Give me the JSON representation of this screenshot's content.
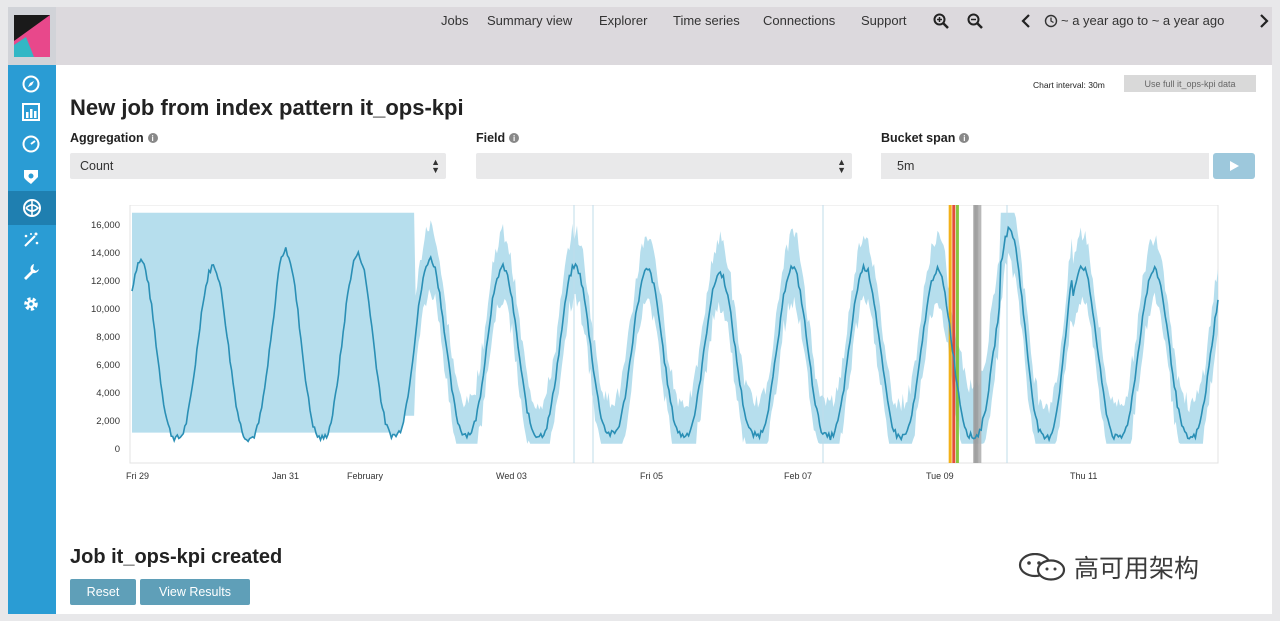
{
  "nav": {
    "items": [
      "Jobs",
      "Summary view",
      "Explorer",
      "Time series",
      "Connections",
      "Support"
    ],
    "time_range": "~ a year ago to ~ a year ago",
    "icons": [
      "zoom-in-icon",
      "zoom-out-icon",
      "chevron-left-icon",
      "clock-icon",
      "chevron-right-icon"
    ]
  },
  "sidebar": {
    "icons": [
      "compass-icon",
      "bar-chart-icon",
      "gauge-icon",
      "shield-icon",
      "machine-learning-icon",
      "sparkle-icon",
      "wrench-icon",
      "gear-icon"
    ],
    "active_index": 4,
    "colors": {
      "bar": "#2a9cd4",
      "active": "#1f7fb0",
      "logo_pink": "#e8488b"
    }
  },
  "toolbar": {
    "chart_interval": "Chart interval: 30m",
    "use_full_button": "Use full it_ops-kpi data"
  },
  "page": {
    "title": "New job from index pattern it_ops-kpi"
  },
  "form": {
    "aggregation": {
      "label": "Aggregation",
      "value": "Count"
    },
    "field": {
      "label": "Field",
      "value": ""
    },
    "bucket_span": {
      "label": "Bucket span",
      "value": "5m"
    }
  },
  "chart_data": {
    "type": "line",
    "series": [
      {
        "name": "",
        "type": "line",
        "color": "#2a8fb5"
      },
      {
        "name": "",
        "type": "area",
        "color": "#a9d8ea"
      }
    ],
    "x_ticks": [
      "Fri 29",
      "Jan 31",
      "February",
      "Wed 03",
      "Fri 05",
      "Feb 07",
      "Tue 09",
      "Thu 11"
    ],
    "y_ticks": [
      "0",
      "2,000",
      "4,000",
      "6,000",
      "8,000",
      "10,000",
      "12,000",
      "14,000",
      "16,000"
    ],
    "ylim": [
      0,
      16000
    ],
    "cycles_days": 15,
    "daily_peaks": [
      13400,
      13000,
      14100,
      13800,
      13500,
      12900,
      13000,
      12700,
      12500,
      12900,
      12900,
      12700,
      15600,
      13000,
      12700,
      12500
    ],
    "daily_troughs": [
      700,
      700,
      700,
      900,
      1000,
      900,
      1000,
      900,
      900,
      800,
      800,
      800,
      700,
      700,
      700,
      600
    ],
    "highlights": [
      {
        "day": 11.28,
        "color": "#f2a900"
      },
      {
        "day": 11.33,
        "color": "#e03b24"
      },
      {
        "day": 11.38,
        "color": "#7bbf2a"
      },
      {
        "day": 11.62,
        "color": "#9b9b9b"
      },
      {
        "day": 11.65,
        "color": "#9b9b9b"
      },
      {
        "day": 11.69,
        "color": "#b0b0b0"
      }
    ],
    "grid": false
  },
  "result": {
    "created_text": "Job it_ops-kpi created",
    "reset_label": "Reset",
    "view_results_label": "View Results"
  },
  "watermark": {
    "text": "高可用架构"
  }
}
